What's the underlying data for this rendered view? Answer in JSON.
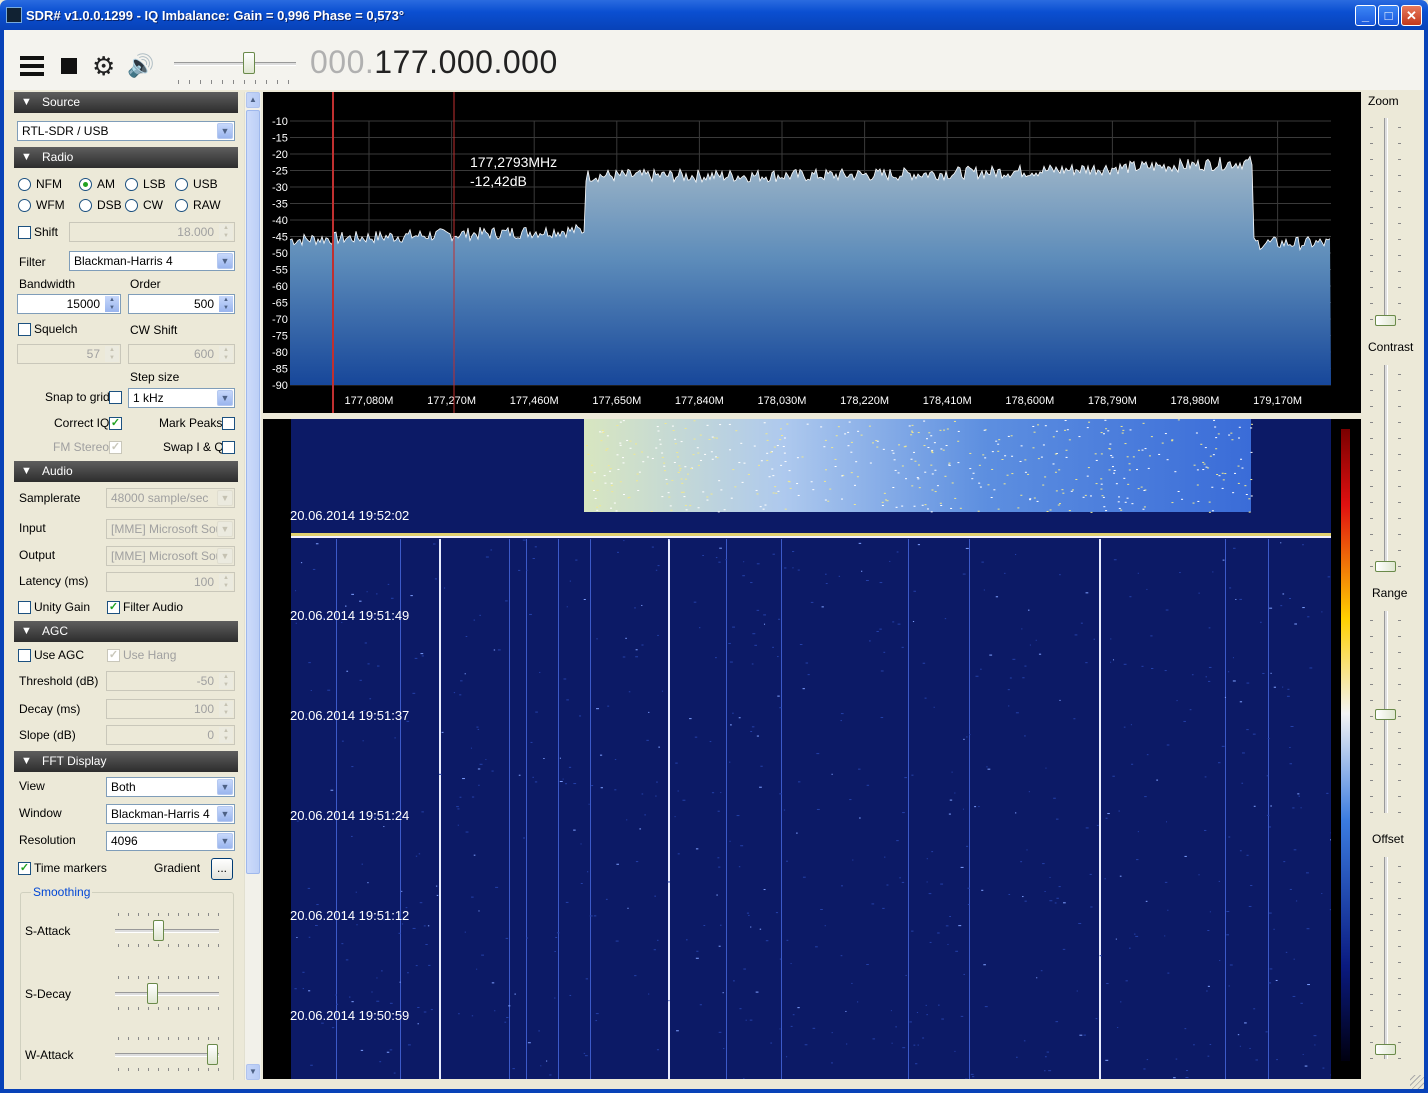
{
  "window": {
    "title": "SDR# v1.0.0.1299 - IQ Imbalance: Gain = 0,996 Phase = 0,573°",
    "minimize_label": "_",
    "maximize_label": "□",
    "close_label": "✕"
  },
  "toolbar": {
    "freq_dim": "000.",
    "freq_main": "177.000.000",
    "volume": 0.62
  },
  "source": {
    "header": "Source",
    "device": "RTL-SDR / USB"
  },
  "radio": {
    "header": "Radio",
    "modes": [
      "NFM",
      "AM",
      "LSB",
      "USB",
      "WFM",
      "DSB",
      "CW",
      "RAW"
    ],
    "selected_mode": "AM",
    "shift_label": "Shift",
    "shift_value": "18.000",
    "filter_label": "Filter",
    "filter_value": "Blackman-Harris 4",
    "bandwidth_label": "Bandwidth",
    "bandwidth_value": "15000",
    "order_label": "Order",
    "order_value": "500",
    "squelch_label": "Squelch",
    "squelch_value": "57",
    "cw_shift_label": "CW Shift",
    "cw_shift_value": "600",
    "step_size_label": "Step size",
    "snap_to_grid_label": "Snap to grid",
    "step_size_value": "1 kHz",
    "correct_iq_label": "Correct IQ",
    "mark_peaks_label": "Mark Peaks",
    "fm_stereo_label": "FM Stereo",
    "swap_iq_label": "Swap I & Q"
  },
  "audio": {
    "header": "Audio",
    "samplerate_label": "Samplerate",
    "samplerate_value": "48000 sample/sec",
    "input_label": "Input",
    "input_value": "[MME] Microsoft Soun",
    "output_label": "Output",
    "output_value": "[MME] Microsoft Soun",
    "latency_label": "Latency (ms)",
    "latency_value": "100",
    "unity_gain_label": "Unity Gain",
    "filter_audio_label": "Filter Audio"
  },
  "agc": {
    "header": "AGC",
    "use_agc_label": "Use AGC",
    "use_hang_label": "Use Hang",
    "threshold_label": "Threshold (dB)",
    "threshold_value": "-50",
    "decay_label": "Decay (ms)",
    "decay_value": "100",
    "slope_label": "Slope (dB)",
    "slope_value": "0"
  },
  "fft": {
    "header": "FFT Display",
    "view_label": "View",
    "view_value": "Both",
    "window_label": "Window",
    "window_value": "Blackman-Harris 4",
    "resolution_label": "Resolution",
    "resolution_value": "4096",
    "time_markers_label": "Time markers",
    "gradient_label": "Gradient",
    "gradient_button": "...",
    "smoothing_title": "Smoothing",
    "s_attack_label": "S-Attack",
    "s_decay_label": "S-Decay",
    "w_attack_label": "W-Attack",
    "s_attack_level": 0.4,
    "s_decay_level": 0.34,
    "w_attack_level": 0.98
  },
  "right": {
    "zoom_label": "Zoom",
    "contrast_label": "Contrast",
    "range_label": "Range",
    "offset_label": "Offset"
  },
  "spectrum": {
    "y_ticks": [
      "-10",
      "-15",
      "-20",
      "-25",
      "-30",
      "-35",
      "-40",
      "-45",
      "-50",
      "-55",
      "-60",
      "-65",
      "-70",
      "-75",
      "-80",
      "-85",
      "-90"
    ],
    "x_ticks": [
      "177,080M",
      "177,270M",
      "177,460M",
      "177,650M",
      "177,840M",
      "178,030M",
      "178,220M",
      "178,410M",
      "178,600M",
      "178,790M",
      "178,980M",
      "179,170M"
    ],
    "cursor_freq": "177,2793MHz",
    "cursor_level": "-12,42dB",
    "colors": {
      "fill_top": "#8fb0c8",
      "fill_bottom": "#1a4f98",
      "grid": "#3a3a3a",
      "marker": "#cc2020"
    }
  },
  "waterfall": {
    "timestamps": [
      "20.06.2014 19:52:02",
      "20.06.2014 19:51:49",
      "20.06.2014 19:51:37",
      "20.06.2014 19:51:24",
      "20.06.2014 19:51:12",
      "20.06.2014 19:50:59"
    ]
  }
}
